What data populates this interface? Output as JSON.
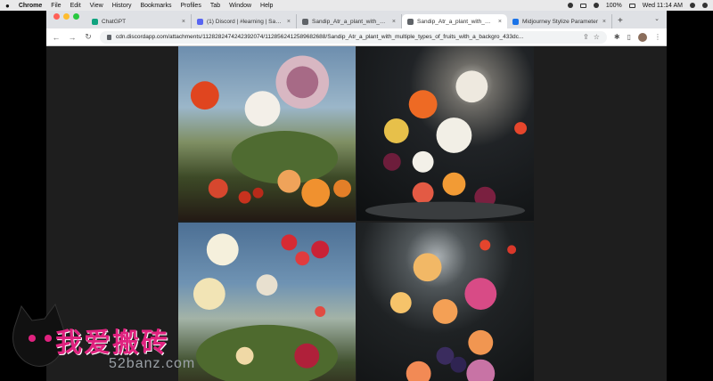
{
  "menubar": {
    "app": "Chrome",
    "items": [
      "File",
      "Edit",
      "View",
      "History",
      "Bookmarks",
      "Profiles",
      "Tab",
      "Window",
      "Help"
    ],
    "battery": "100%",
    "clock": "Wed 11:14 AM"
  },
  "tabs": [
    {
      "title": "ChatGPT",
      "favicon_color": "#10a37f",
      "active": false
    },
    {
      "title": "(1) Discord | #learning | Sandip",
      "favicon_color": "#5865f2",
      "active": false
    },
    {
      "title": "Sandip_Atr_a_plant_with_multip",
      "favicon_color": "#5f6368",
      "active": false
    },
    {
      "title": "Sandip_Atr_a_plant_with_multip",
      "favicon_color": "#5f6368",
      "active": true
    },
    {
      "title": "Midjourney Stylize Parameter",
      "favicon_color": "#1a73e8",
      "active": false
    }
  ],
  "toolbar": {
    "url": "cdn.discordapp.com/attachments/1128282474242392074/1128562412589682688/Sandip_Atr_a_plant_with_multiple_types_of_fruits_with_a_backgro_433dc..."
  },
  "image": {
    "panels": [
      "top-left",
      "top-right",
      "bottom-left",
      "bottom-right"
    ]
  },
  "watermark": {
    "chinese": "我爱搬砖",
    "domain": "52banz.com"
  },
  "colors": {
    "accent_pink": "#e0227f",
    "chrome_bg": "#dfe1e5"
  }
}
